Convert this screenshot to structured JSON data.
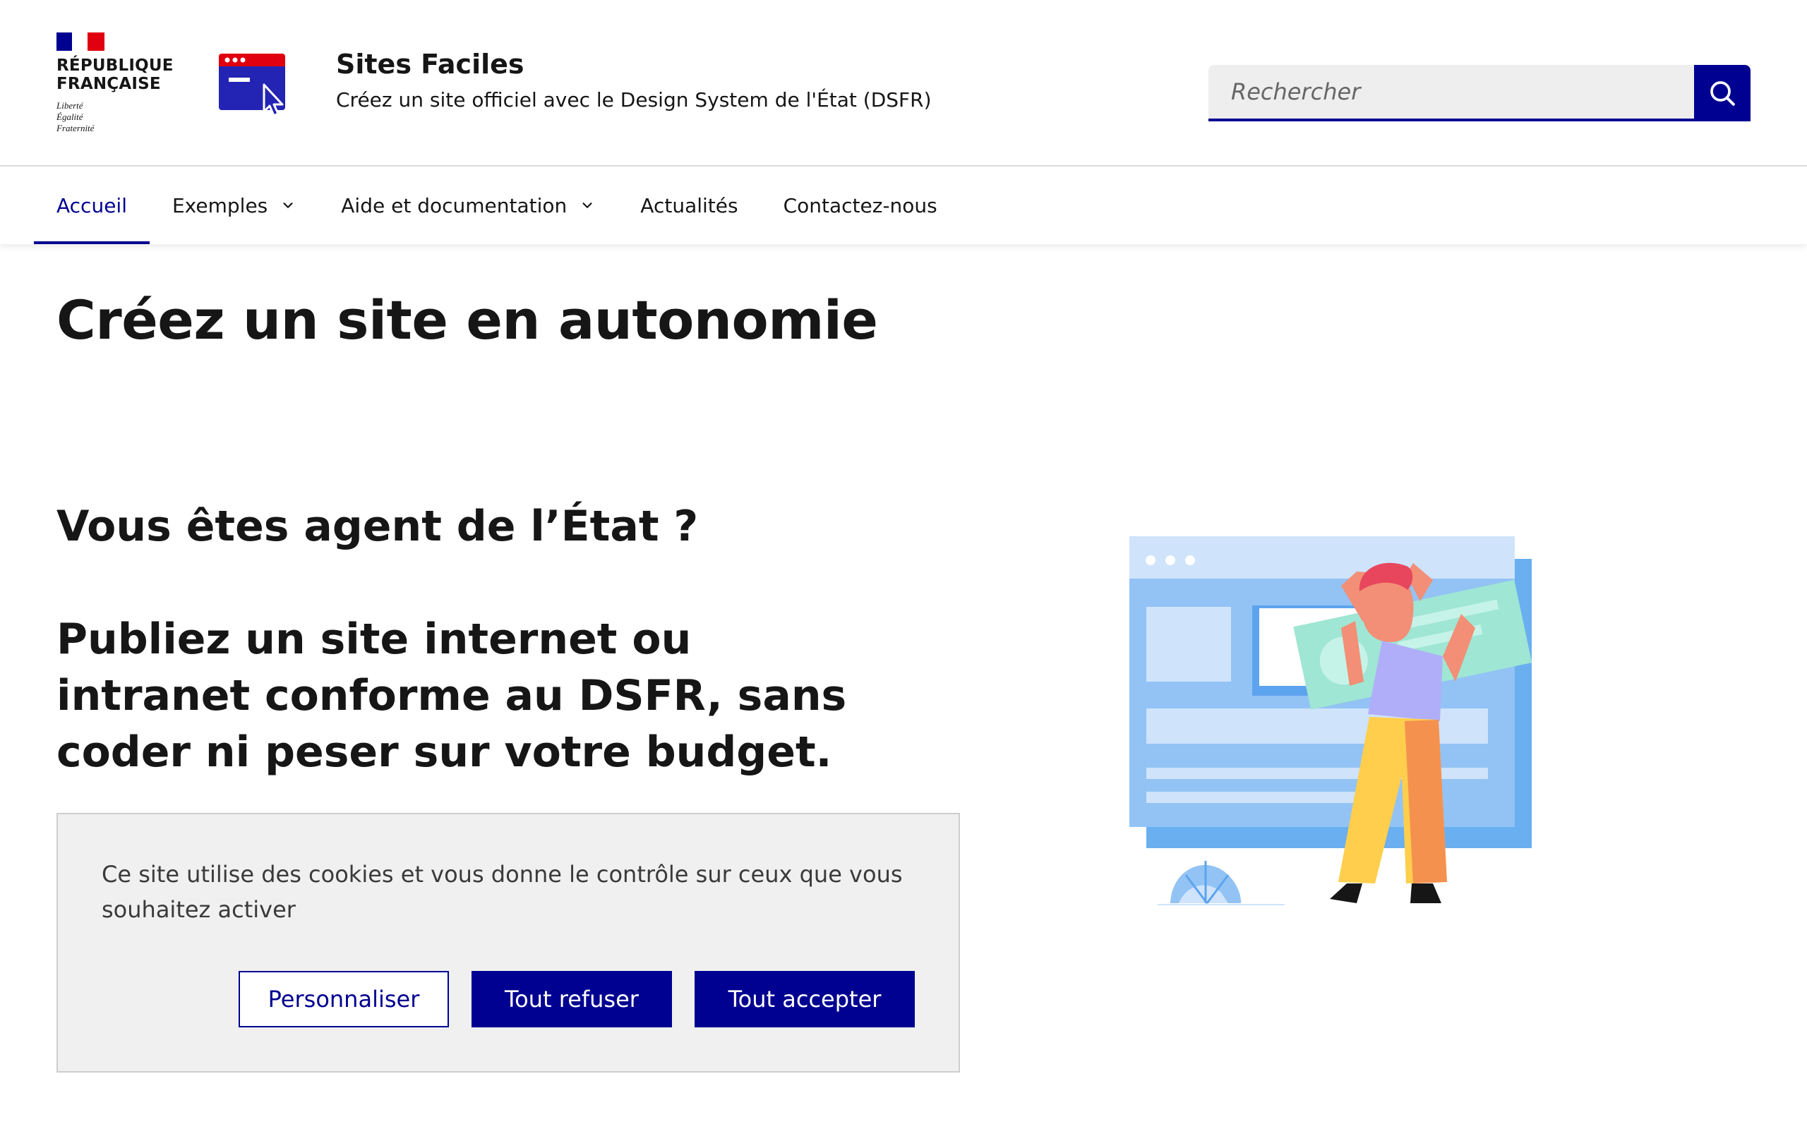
{
  "header": {
    "republic_line1": "RÉPUBLIQUE",
    "republic_line2": "FRANÇAISE",
    "motto": [
      "Liberté",
      "Égalité",
      "Fraternité"
    ],
    "service_title": "Sites Faciles",
    "service_tagline": "Créez un site officiel avec le Design System de l'État (DSFR)",
    "search": {
      "placeholder": "Rechercher"
    }
  },
  "nav": {
    "items": [
      {
        "label": "Accueil",
        "active": true
      },
      {
        "label": "Exemples",
        "dropdown": true
      },
      {
        "label": "Aide et documentation",
        "dropdown": true
      },
      {
        "label": "Actualités"
      },
      {
        "label": "Contactez-nous"
      }
    ]
  },
  "main": {
    "title": "Créez un site en autonomie",
    "question": "Vous êtes agent de l’État ?",
    "lead": "Publiez un site internet ou intranet conforme au DSFR, sans coder ni peser sur votre budget."
  },
  "cookie_banner": {
    "text": "Ce site utilise des cookies et vous donne le contrôle sur ceux que vous souhaitez activer",
    "buttons": {
      "customize": "Personnaliser",
      "refuse": "Tout refuser",
      "accept": "Tout accepter"
    }
  },
  "colors": {
    "primary": "#000091",
    "flag_red": "#e1000f",
    "banner_bg": "#f0f0f0",
    "text": "#161616"
  }
}
